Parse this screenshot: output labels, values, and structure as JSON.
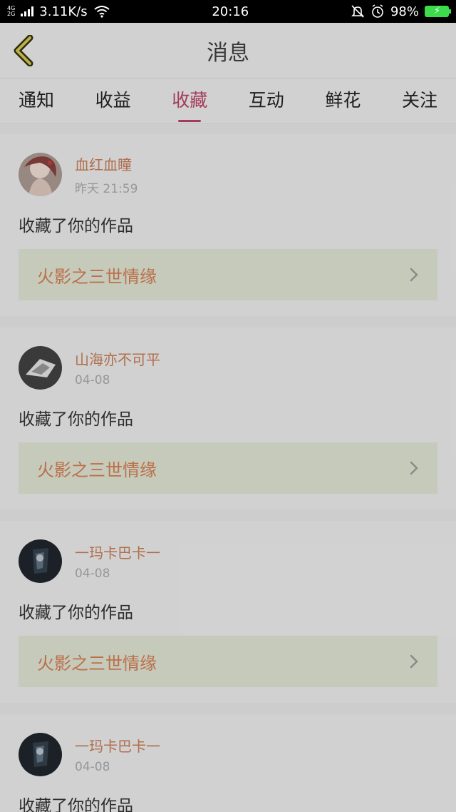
{
  "status_bar": {
    "network_top": "4G",
    "network_bottom": "2G",
    "speed": "3.11K/s",
    "time": "20:16",
    "battery": "98%"
  },
  "header": {
    "title": "消息",
    "back_icon": "chevron-left-icon"
  },
  "tabs": [
    {
      "label": "通知"
    },
    {
      "label": "收益"
    },
    {
      "label": "收藏"
    },
    {
      "label": "互动"
    },
    {
      "label": "鲜花"
    },
    {
      "label": "关注"
    }
  ],
  "active_tab": "收藏",
  "messages": [
    {
      "name": "血红血瞳",
      "time": "昨天 21:59",
      "action": "收藏了你的作品",
      "work": "火影之三世情缘"
    },
    {
      "name": "山海亦不可平",
      "time": "04-08",
      "action": "收藏了你的作品",
      "work": "火影之三世情缘"
    },
    {
      "name": "一玛卡巴卡一",
      "time": "04-08",
      "action": "收藏了你的作品",
      "work": "火影之三世情缘"
    },
    {
      "name": "一玛卡巴卡一",
      "time": "04-08",
      "action": "收藏了你的作品"
    }
  ],
  "colors": {
    "accent": "#a83d5c",
    "username": "#b4714e",
    "work_title": "#c0724c",
    "battery": "#3ddc4a"
  }
}
